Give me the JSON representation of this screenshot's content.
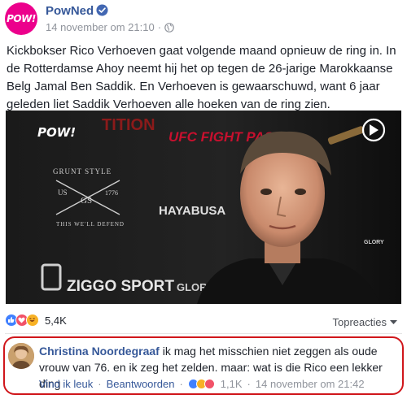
{
  "post": {
    "page_name": "PowNed",
    "avatar_text": "POW!",
    "timestamp": "14 november om 21:10",
    "separator": "·",
    "body": "Kickbokser Rico Verhoeven gaat volgende maand opnieuw de ring in. In de Rotterdamse Ahoy neemt hij het op tegen de 26-jarige Marokkaanse Belg Jamal Ben Saddik. En Verhoeven is gewaarschuwd, want 6 jaar geleden liet Saddik Verhoeven alle hoeken van de ring zien."
  },
  "video": {
    "watermark_left": "POW!",
    "backdrop_texts": [
      "UFC FIGHT PASS",
      "HAYABUSA",
      "ZIGGO SPORT",
      "GLORY",
      "GRUNT STYLE",
      "US",
      "GS",
      "1776",
      "THIS WE'LL DEFEND",
      "GLORY",
      "TITION"
    ]
  },
  "reactions": {
    "count": "5,4K",
    "icons": [
      "like-icon",
      "love-icon",
      "haha-icon"
    ],
    "colors": {
      "like": "#4080ff",
      "love": "#f25268",
      "haha": "#f7b125"
    }
  },
  "sort": {
    "label": "Topreacties"
  },
  "comment": {
    "author": "Christina Noordegraaf",
    "text": "ik mag het misschien niet zeggen als oude vrouw van 76. en ik zeg het zelden. maar: wat is die Rico een lekker ding",
    "like_label": "Vind ik leuk",
    "reply_label": "Beantwoorden",
    "separator": "·",
    "reaction_count": "1,1K",
    "timestamp": "14 november om 21:42"
  },
  "colors": {
    "brand_pink": "#ec008c",
    "link": "#365899",
    "highlight": "#d0161b"
  }
}
